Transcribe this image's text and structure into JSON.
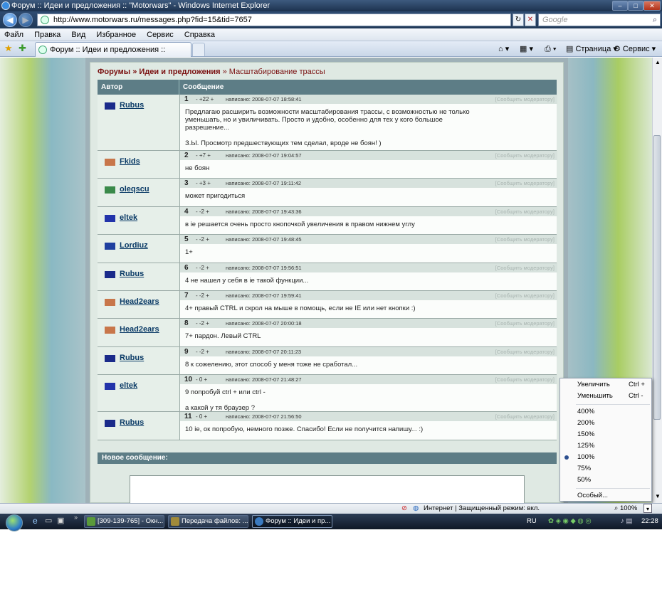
{
  "window": {
    "title": "Форум :: Идеи и предложения :: \"Motorwars\" - Windows Internet Explorer"
  },
  "address": {
    "url": "http://www.motorwars.ru/messages.php?fid=15&tid=7657",
    "search_placeholder": "Google"
  },
  "menu": [
    "Файл",
    "Правка",
    "Вид",
    "Избранное",
    "Сервис",
    "Справка"
  ],
  "tab": {
    "label": "Форум :: Идеи и предложения :: \"Motorwars\""
  },
  "toolbar": {
    "page": "Страница",
    "service": "Сервис"
  },
  "breadcrumb": {
    "forums": "Форумы",
    "sep1": " » ",
    "section": "Идеи и предложения",
    "sep2": " » ",
    "topic": "Масштабирование трассы"
  },
  "table": {
    "col_author": "Автор",
    "col_message": "Сообщение"
  },
  "report_label": "[Сообщить модератору]",
  "posts": [
    {
      "num": "1",
      "rating": "- +22 +",
      "date": "написано: 2008-07-07 18:58:41",
      "author": "Rubus",
      "flag": "#1a2a8a",
      "text": "Предлагаю расширить возможности масштабирования трассы, с возможностью не только\nуменьшать, но и увиличивать. Просто и удобно, особенно для тех у кого большое\nразрешение...\n\nЗ.Ы. Просмотр предшествующих тем сделал, вроде не боян! )"
    },
    {
      "num": "2",
      "rating": "- +7 +",
      "date": "написано: 2008-07-07 19:04:57",
      "author": "Fkids",
      "flag": "#c8764a",
      "text": "не боян"
    },
    {
      "num": "3",
      "rating": "- +3 +",
      "date": "написано: 2008-07-07 19:11:42",
      "author": "oleqscu",
      "flag": "#3a8a4a",
      "text": "может пригодиться"
    },
    {
      "num": "4",
      "rating": "- -2 +",
      "date": "написано: 2008-07-07 19:43:36",
      "author": "eltek",
      "flag": "#2233aa",
      "text": "в ie решается очень просто кнопочкой увеличения в правом нижнем углу"
    },
    {
      "num": "5",
      "rating": "- -2 +",
      "date": "написано: 2008-07-07 19:48:45",
      "author": "Lordiuz",
      "flag": "#1f3f9f",
      "text": "1+"
    },
    {
      "num": "6",
      "rating": "- -2 +",
      "date": "написано: 2008-07-07 19:56:51",
      "author": "Rubus",
      "flag": "#1a2a8a",
      "text": "4 не нашел у себя в ie такой функции..."
    },
    {
      "num": "7",
      "rating": "- -2 +",
      "date": "написано: 2008-07-07 19:59:41",
      "author": "Head2ears",
      "flag": "#c8764a",
      "text": "4+ правый CTRL и скрол на мыше в помощь, если не IE или нет кнопки :)"
    },
    {
      "num": "8",
      "rating": "- -2 +",
      "date": "написано: 2008-07-07 20:00:18",
      "author": "Head2ears",
      "flag": "#c8764a",
      "text": "7+ пардон. Левый CTRL"
    },
    {
      "num": "9",
      "rating": "- -2 +",
      "date": "написано: 2008-07-07 20:11:23",
      "author": "Rubus",
      "flag": "#1a2a8a",
      "text": "8 к сожелению, этот способ у меня тоже не сработал..."
    },
    {
      "num": "10",
      "rating": "- 0 +",
      "date": "написано: 2008-07-07 21:48:27",
      "author": "eltek",
      "flag": "#2233aa",
      "text": "9 попробуй ctrl + или ctrl -\n\nа какой у тя браузер ?"
    },
    {
      "num": "11",
      "rating": "- 0 +",
      "date": "написано: 2008-07-07 21:56:50",
      "author": "Rubus",
      "flag": "#1a2a8a",
      "text": "10 ie, ок попробую, немного позже. Спасибо! Если не получится напишу... :)"
    }
  ],
  "new_message": "Новое сообщение:",
  "zoom_menu": {
    "zoom_in": "Увеличить",
    "zoom_in_key": "Ctrl +",
    "zoom_out": "Уменьшить",
    "zoom_out_key": "Ctrl -",
    "levels": [
      "400%",
      "200%",
      "150%",
      "125%",
      "100%",
      "75%",
      "50%"
    ],
    "selected": "100%",
    "custom": "Особый..."
  },
  "status": {
    "zone": "Интернет | Защищенный режим: вкл.",
    "zoom": "100%"
  },
  "taskbar": {
    "items": [
      "[309-139-765] - Окн...",
      "Передача файлов: ...",
      "Форум :: Идеи и пр..."
    ],
    "lang": "RU",
    "time": "22:28"
  }
}
